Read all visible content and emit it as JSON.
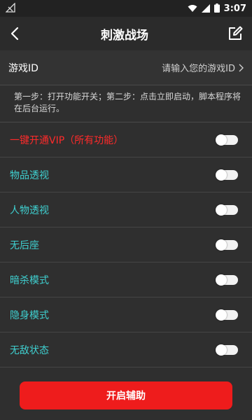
{
  "status_bar": {
    "time": "3:07"
  },
  "header": {
    "title": "刺激战场"
  },
  "game_id": {
    "label": "游戏ID",
    "placeholder": "请输入您的游戏ID"
  },
  "instructions": "第一步：打开功能开关；第二步：点击立即启动，脚本程序将在后台运行。",
  "features": [
    {
      "label": "一键开通VIP（所有功能）",
      "color": "#ff2a2a"
    },
    {
      "label": "物品透视",
      "color": "#3fd0d0"
    },
    {
      "label": "人物透视",
      "color": "#3fd0d0"
    },
    {
      "label": "无后座",
      "color": "#3fd0d0"
    },
    {
      "label": "暗杀模式",
      "color": "#3fd0d0"
    },
    {
      "label": "隐身模式",
      "color": "#3fd0d0"
    },
    {
      "label": "无敌状态",
      "color": "#3fd0d0"
    }
  ],
  "start_button": {
    "label": "开启辅助",
    "color": "#ee1c1c"
  }
}
